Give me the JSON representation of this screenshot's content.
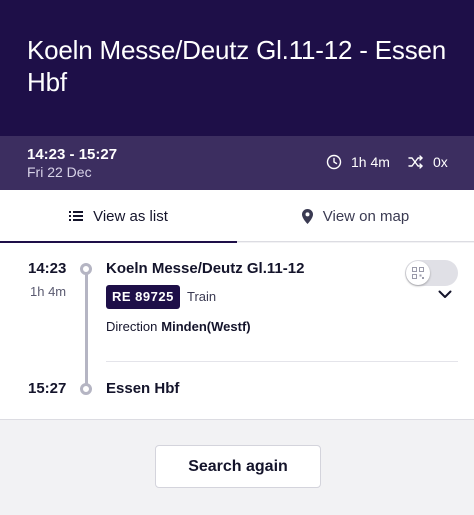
{
  "header": {
    "title": "Koeln Messe/Deutz Gl.11-12 - Essen Hbf"
  },
  "summary": {
    "time_range": "14:23 - 15:27",
    "date": "Fri 22 Dec",
    "duration": "1h 4m",
    "changes": "0x",
    "duration_icon": "clock-icon",
    "changes_icon": "shuffle-icon"
  },
  "tabs": [
    {
      "label": "View as list",
      "icon": "list-icon",
      "active": true
    },
    {
      "label": "View on map",
      "icon": "location-pin-icon",
      "active": false
    }
  ],
  "journey": {
    "departure": {
      "time": "14:23",
      "stop": "Koeln Messe/Deutz Gl.11-12",
      "duration": "1h 4m"
    },
    "train": {
      "number": "RE 89725",
      "type": "Train",
      "direction_label": "Direction",
      "direction": "Minden(Westf)"
    },
    "arrival": {
      "time": "15:27",
      "stop": "Essen Hbf"
    }
  },
  "actions": {
    "search_again": "Search again"
  },
  "colors": {
    "header_bg": "#1e0f48",
    "summary_bg": "#3c2e60",
    "badge_bg": "#1e0f48",
    "page_bg": "#f2f2f4"
  }
}
